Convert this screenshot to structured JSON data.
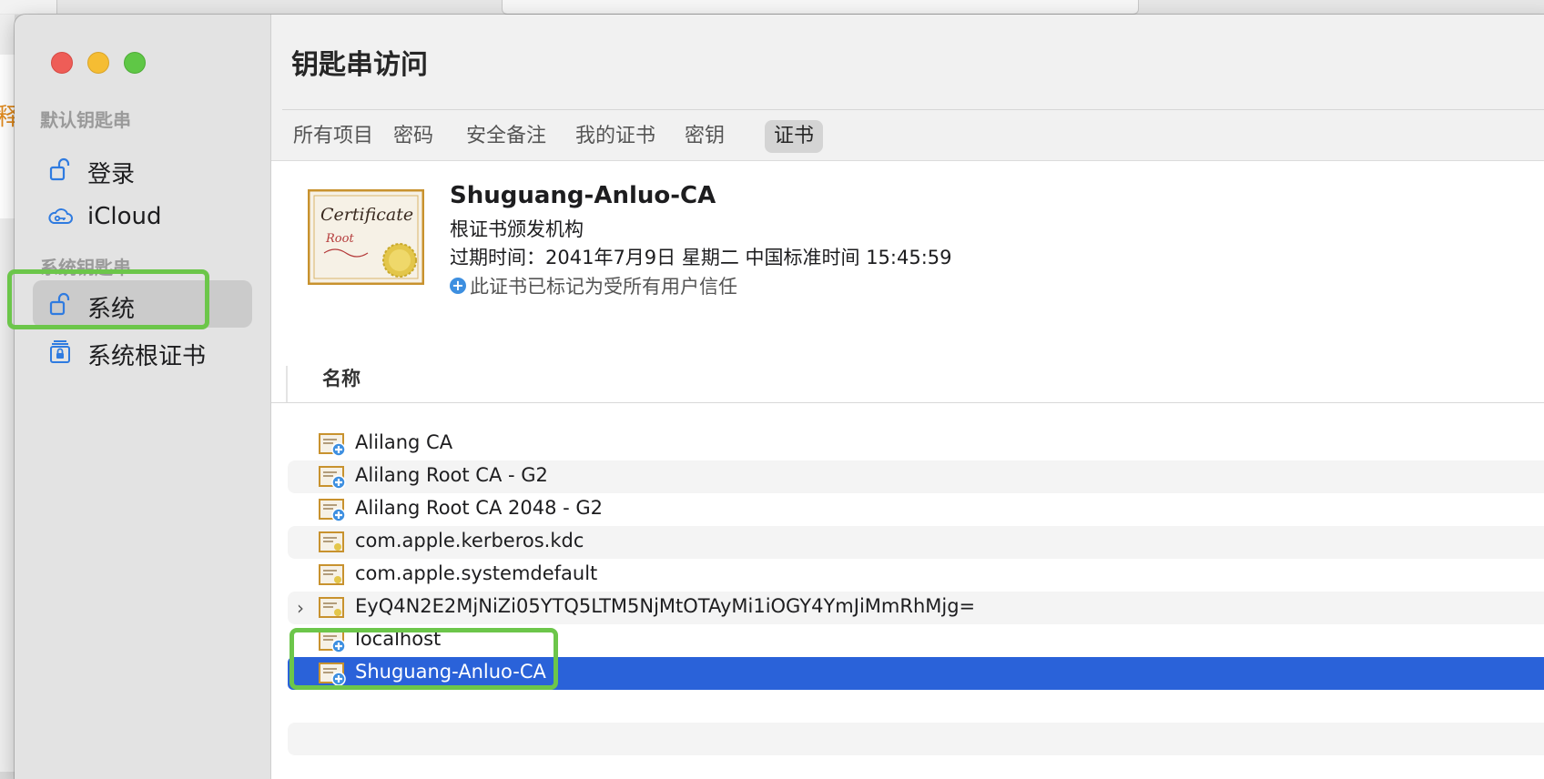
{
  "background": {
    "peek_text": "释"
  },
  "window": {
    "title": "钥匙串访问",
    "traffic_lights": {
      "close": "#ee5d57",
      "minimize": "#f5bd33",
      "zoom": "#5fc746"
    }
  },
  "sidebar": {
    "default_section": "默认钥匙串",
    "default_items": [
      {
        "label": "登录",
        "icon": "unlock-icon"
      },
      {
        "label": "iCloud",
        "icon": "cloud-key-icon"
      }
    ],
    "system_section": "系统钥匙串",
    "system_items": [
      {
        "label": "系统",
        "icon": "unlock-icon",
        "selected": true
      },
      {
        "label": "系统根证书",
        "icon": "lock-cabinet-icon"
      }
    ]
  },
  "tabs": [
    {
      "label": "所有项目"
    },
    {
      "label": "密码"
    },
    {
      "label": "安全备注"
    },
    {
      "label": "我的证书"
    },
    {
      "label": "密钥"
    },
    {
      "label": "证书",
      "active": true
    }
  ],
  "detail": {
    "name": "Shuguang-Anluo-CA",
    "kind": "根证书颁发机构",
    "expires": "过期时间：2041年7月9日 星期二 中国标准时间 15:45:59",
    "trust": "此证书已标记为受所有用户信任",
    "icon_text": {
      "line1": "Certificate",
      "line2": "Root"
    }
  },
  "list": {
    "column_name": "名称",
    "rows": [
      {
        "label": "Alilang CA",
        "trusted": true
      },
      {
        "label": "Alilang Root CA - G2",
        "trusted": true
      },
      {
        "label": "Alilang Root CA 2048 - G2",
        "trusted": true
      },
      {
        "label": "com.apple.kerberos.kdc",
        "trusted": false
      },
      {
        "label": "com.apple.systemdefault",
        "trusted": false
      },
      {
        "label": "EyQ4N2E2MjNiZi05YTQ5LTM5NjMtOTAyMi1iOGY4YmJiMmRhMjg=",
        "trusted": false,
        "expandable": true
      },
      {
        "label": "localhost",
        "trusted": true
      },
      {
        "label": "Shuguang-Anluo-CA",
        "trusted": true,
        "selected": true
      }
    ]
  },
  "colors": {
    "selection": "#2a62d9",
    "highlight": "#6cc64a",
    "trust_badge": "#3d8fe0"
  }
}
